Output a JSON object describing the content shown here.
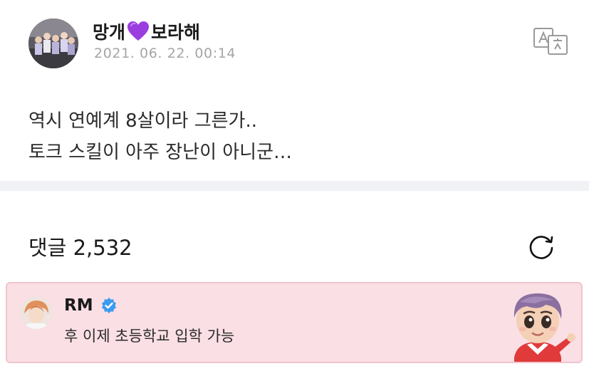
{
  "post": {
    "author_name_before": "망개",
    "author_name_after": "보라해",
    "author_emoji": "purple-heart",
    "timestamp": "2021. 06. 22. 00:14",
    "body_lines": [
      "역시 연예계 8살이라 그른가..",
      "토크 스킬이 아주 장난이 아니군…"
    ]
  },
  "comments": {
    "title": "댓글 2,532",
    "items": [
      {
        "author": "RM",
        "verified": true,
        "text": "후 이제 초등학교 입학 가능"
      }
    ]
  },
  "colors": {
    "highlight_bg": "#fadfe5",
    "verified": "#3b9cf0",
    "heart": "#9b3ee0",
    "timestamp": "#a5a5a5"
  }
}
